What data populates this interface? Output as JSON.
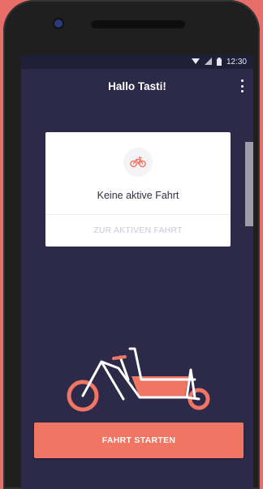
{
  "status_bar": {
    "time": "12:30"
  },
  "app_bar": {
    "title": "Hallo Tasti!"
  },
  "ride_card": {
    "title": "Keine aktive Fahrt",
    "action_label": "ZUR AKTIVEN FAHRT"
  },
  "primary_action": {
    "label": "FAHRT STARTEN"
  },
  "colors": {
    "background": "#2c2a48",
    "accent": "#f07563",
    "frame": "#ffffff"
  },
  "icons": [
    "wifi-icon",
    "signal-icon",
    "battery-icon",
    "more-vert-icon",
    "bicycle-icon",
    "cargo-bike-illustration"
  ]
}
